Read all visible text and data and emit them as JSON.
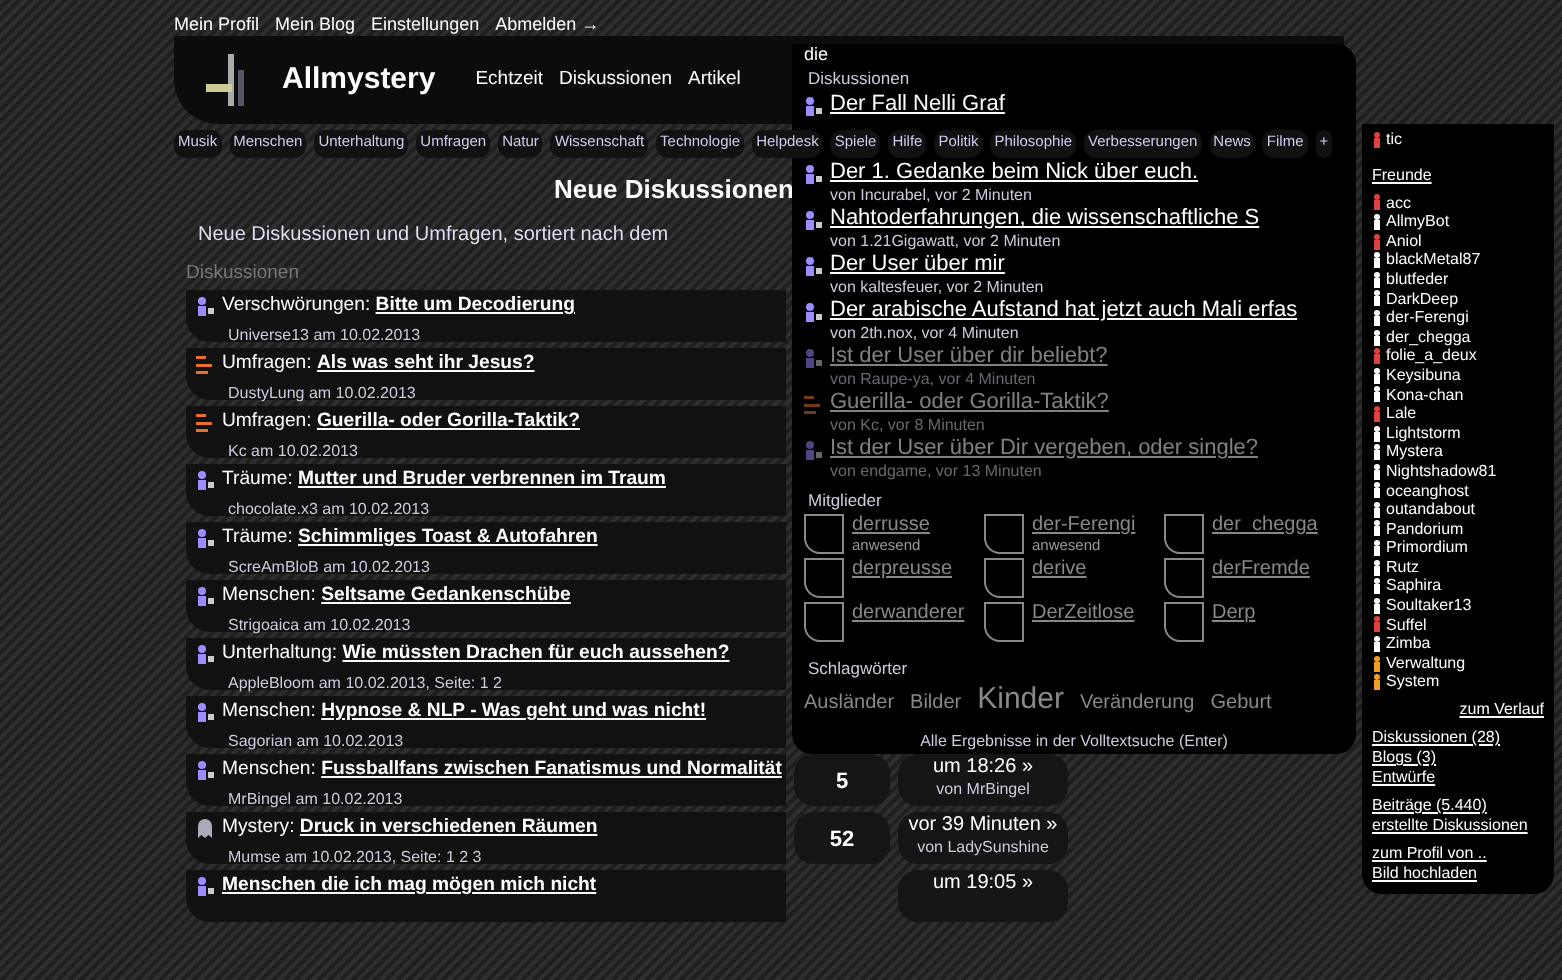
{
  "top_links": [
    "Mein Profil",
    "Mein Blog",
    "Einstellungen",
    "Abmelden →"
  ],
  "header": {
    "site_name": "Allmystery",
    "nav": [
      "Echtzeit",
      "Diskussionen",
      "Artikel"
    ]
  },
  "categories": [
    "Musik",
    "Menschen",
    "Unterhaltung",
    "Umfragen",
    "Natur",
    "Wissenschaft",
    "Technologie",
    "Helpdesk",
    "Spiele",
    "Hilfe",
    "Politik",
    "Philosophie",
    "Verbesserungen",
    "News",
    "Filme",
    "+"
  ],
  "page": {
    "title": "Neue Diskussionen",
    "subtitle": "Neue Diskussionen und Umfragen, sortiert nach dem",
    "section": "Diskussionen"
  },
  "discussions": [
    {
      "kind": "thread",
      "category": "Verschwörungen:",
      "title": "Bitte um Decodierung",
      "meta": "Universe13 am 10.02.2013"
    },
    {
      "kind": "poll",
      "category": "Umfragen:",
      "title": "Als was seht ihr Jesus?",
      "meta": "DustyLung am 10.02.2013"
    },
    {
      "kind": "poll",
      "category": "Umfragen:",
      "title": "Guerilla- oder Gorilla-Taktik?",
      "meta": "Kc am 10.02.2013"
    },
    {
      "kind": "thread",
      "category": "Träume:",
      "title": "Mutter und Bruder verbrennen im Traum",
      "meta": "chocolate.x3 am 10.02.2013"
    },
    {
      "kind": "thread",
      "category": "Träume:",
      "title": "Schimmliges Toast & Autofahren",
      "meta": "ScreAmBloB am 10.02.2013"
    },
    {
      "kind": "thread",
      "category": "Menschen:",
      "title": "Seltsame Gedankenschübe",
      "meta": "Strigoaica am 10.02.2013"
    },
    {
      "kind": "thread",
      "category": "Unterhaltung:",
      "title": "Wie müssten Drachen für euch aussehen?",
      "meta": "AppleBloom am 10.02.2013, Seite: 1 2"
    },
    {
      "kind": "thread",
      "category": "Menschen:",
      "title": "Hypnose & NLP - Was geht und was nicht!",
      "meta": "Sagorian am 10.02.2013"
    },
    {
      "kind": "thread",
      "category": "Menschen:",
      "title": "Fussballfans zwischen Fanatismus und Normalität",
      "meta": "MrBingel am 10.02.2013",
      "count": "5",
      "last": "um 18:26 »",
      "last_by": "von MrBingel"
    },
    {
      "kind": "mystery",
      "category": "Mystery:",
      "title": "Druck in verschiedenen Räumen",
      "meta": "Mumse am 10.02.2013, Seite: 1 2 3",
      "count": "52",
      "last": "vor 39 Minuten »",
      "last_by": "von LadySunshine"
    },
    {
      "kind": "thread",
      "title": "Menschen die ich mag mögen mich nicht",
      "last": "um 19:05 »"
    }
  ],
  "search": {
    "value": "die",
    "section": "Diskussionen",
    "results": [
      {
        "kind": "thread",
        "title": "Der Fall Nelli Graf",
        "dimmed": false
      },
      {
        "kind": "thread",
        "title": "Der 1. Gedanke beim Nick über euch.",
        "meta": "von Incurabel, vor 2 Minuten",
        "dimmed": false
      },
      {
        "kind": "thread",
        "title": "Nahtoderfahrungen, die wissenschaftliche S",
        "meta": "von 1.21Gigawatt, vor 2 Minuten",
        "dimmed": false
      },
      {
        "kind": "thread",
        "title": "Der User über mir",
        "meta": "von kaltesfeuer, vor 2 Minuten",
        "dimmed": false
      },
      {
        "kind": "thread",
        "title": "Der arabische Aufstand hat jetzt auch Mali erfas",
        "meta": "von 2th.nox, vor 4 Minuten",
        "dimmed": false
      },
      {
        "kind": "thread",
        "title": "Ist der User über dir beliebt?",
        "meta": "von Raupe-ya, vor 4 Minuten",
        "dimmed": true
      },
      {
        "kind": "poll",
        "title": "Guerilla- oder Gorilla-Taktik?",
        "meta": "von Kc, vor 8 Minuten",
        "dimmed": true
      },
      {
        "kind": "thread",
        "title": "Ist der User über Dir vergeben, oder single?",
        "meta": "von endgame, vor 13 Minuten",
        "dimmed": true
      }
    ],
    "members_heading": "Mitglieder",
    "members": [
      {
        "name": "derrusse",
        "status": "anwesend"
      },
      {
        "name": "der-Ferengi",
        "status": "anwesend"
      },
      {
        "name": "der_chegga"
      },
      {
        "name": "derpreusse"
      },
      {
        "name": "derive"
      },
      {
        "name": "derFremde"
      },
      {
        "name": "derwanderer"
      },
      {
        "name": "DerZeitlose"
      },
      {
        "name": "Derp"
      }
    ],
    "tags_heading": "Schlagwörter",
    "tags": [
      "Ausländer",
      "Bilder",
      "Kinder",
      "Veränderung",
      "Geburt"
    ],
    "footer": "Alle Ergebnisse in der Volltextsuche (Enter)"
  },
  "friends_panel": {
    "recent": [
      {
        "name": "tic",
        "color": "#e0413a"
      }
    ],
    "heading": "Freunde",
    "friends": [
      {
        "name": "acc",
        "color": "#e0413a"
      },
      {
        "name": "AllmyBot",
        "color": "#ffffff"
      },
      {
        "name": "Aniol",
        "color": "#e0413a"
      },
      {
        "name": "blackMetal87",
        "color": "#ffffff"
      },
      {
        "name": "blutfeder",
        "color": "#ffffff"
      },
      {
        "name": "DarkDeep",
        "color": "#ffffff"
      },
      {
        "name": "der-Ferengi",
        "color": "#ffffff"
      },
      {
        "name": "der_chegga",
        "color": "#ffffff"
      },
      {
        "name": "folie_a_deux",
        "color": "#e0413a"
      },
      {
        "name": "Keysibuna",
        "color": "#ffffff"
      },
      {
        "name": "Kona-chan",
        "color": "#ffffff"
      },
      {
        "name": "Lale",
        "color": "#e0413a"
      },
      {
        "name": "Lightstorm",
        "color": "#ffffff"
      },
      {
        "name": "Mystera",
        "color": "#ffffff"
      },
      {
        "name": "Nightshadow81",
        "color": "#ffffff"
      },
      {
        "name": "oceanghost",
        "color": "#ffffff"
      },
      {
        "name": "outandabout",
        "color": "#ffffff"
      },
      {
        "name": "Pandorium",
        "color": "#ffffff"
      },
      {
        "name": "Primordium",
        "color": "#ffffff"
      },
      {
        "name": "Rutz",
        "color": "#ffffff"
      },
      {
        "name": "Saphira",
        "color": "#ffffff"
      },
      {
        "name": "Soultaker13",
        "color": "#ffffff"
      },
      {
        "name": "Suffel",
        "color": "#e0413a"
      },
      {
        "name": "Zimba",
        "color": "#ffffff"
      },
      {
        "name": "Verwaltung",
        "color": "#f0a020"
      },
      {
        "name": "System",
        "color": "#f0a020"
      }
    ],
    "history_link": "zum Verlauf",
    "links": [
      [
        "Diskussionen (28)",
        "Blogs (3)",
        "Entwürfe"
      ],
      [
        "Beiträge (5.440)",
        "erstellte Diskussionen"
      ],
      [
        "zum Profil von ..",
        "Bild hochladen"
      ]
    ]
  }
}
